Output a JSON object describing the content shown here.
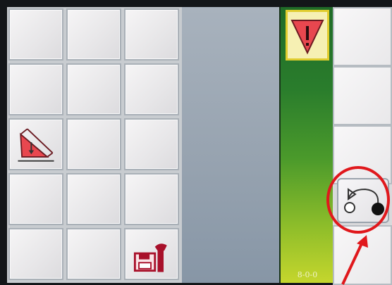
{
  "meter": {
    "reading": "8-0-0"
  },
  "icons": {
    "warning": "warning-triangle-icon",
    "tilt": "tilt-slope-icon",
    "save_settings": "save-settings-icon",
    "sequence": "sequence-play-icon"
  },
  "colors": {
    "warning_red": "#e8474f",
    "highlight_red": "#e0181c",
    "meter_green_top": "#1f6b28",
    "meter_green_bottom": "#c5d62d"
  }
}
